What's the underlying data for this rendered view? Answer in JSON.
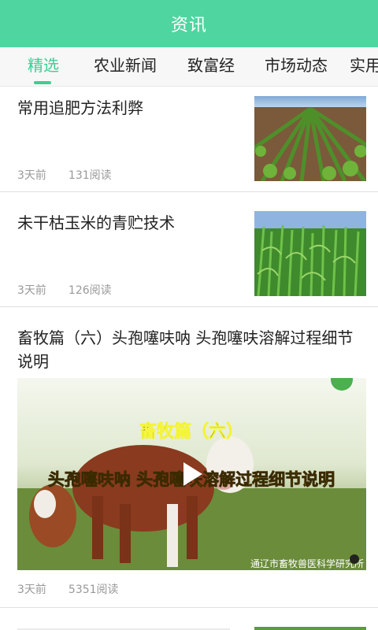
{
  "header": {
    "title": "资讯"
  },
  "tabs": [
    {
      "label": "精选"
    },
    {
      "label": "农业新闻"
    },
    {
      "label": "致富经"
    },
    {
      "label": "市场动态"
    },
    {
      "label": "实用"
    }
  ],
  "articles": [
    {
      "title": "常用追肥方法利弊",
      "time": "3天前",
      "reads": "131阅读",
      "image": "corn-field-image"
    },
    {
      "title": "未干枯玉米的青贮技术",
      "time": "3天前",
      "reads": "126阅读",
      "image": "green-corn-image"
    },
    {
      "title": "畜牧篇（六）头孢噻呋呐 头孢噻呋溶解过程细节说明",
      "time": "3天前",
      "reads": "5351阅读",
      "video": {
        "caption_top": "畜牧篇（六）",
        "caption_main": "头孢噻呋呐 头孢噻呋溶解过程细节说明",
        "watermark": "通辽市畜牧兽医科学研究所"
      }
    }
  ]
}
